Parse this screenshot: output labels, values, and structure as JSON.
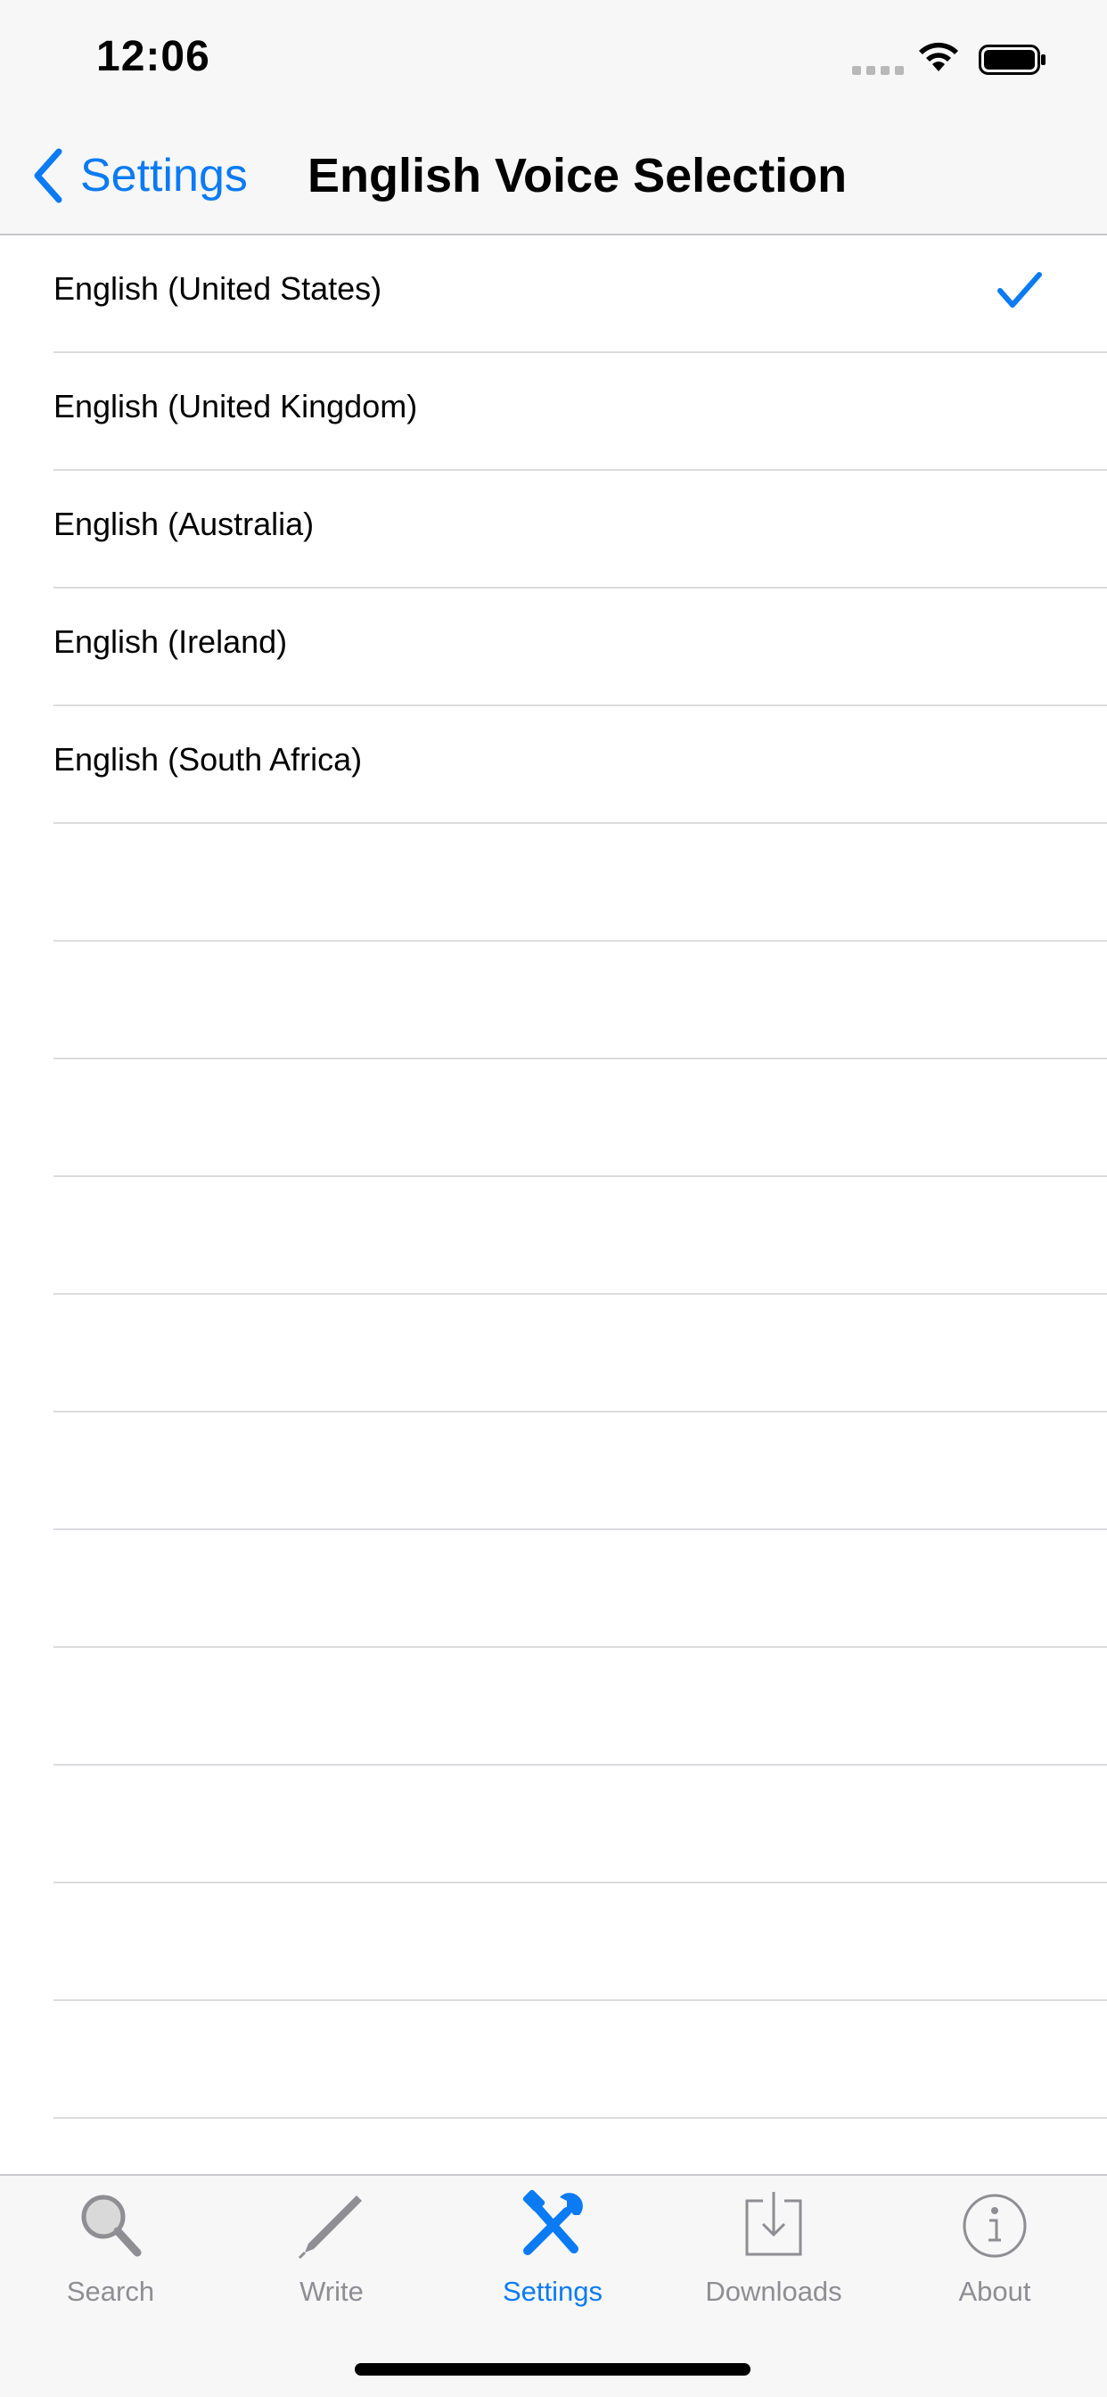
{
  "status_bar": {
    "time": "12:06"
  },
  "nav": {
    "back_label": "Settings",
    "title": "English Voice Selection"
  },
  "voices": [
    {
      "label": "English (United States)",
      "selected": true
    },
    {
      "label": "English (United Kingdom)",
      "selected": false
    },
    {
      "label": "English (Australia)",
      "selected": false
    },
    {
      "label": "English (Ireland)",
      "selected": false
    },
    {
      "label": "English (South Africa)",
      "selected": false
    }
  ],
  "tabs": [
    {
      "label": "Search",
      "icon": "search-icon",
      "active": false
    },
    {
      "label": "Write",
      "icon": "pencil-icon",
      "active": false
    },
    {
      "label": "Settings",
      "icon": "tools-icon",
      "active": true
    },
    {
      "label": "Downloads",
      "icon": "download-icon",
      "active": false
    },
    {
      "label": "About",
      "icon": "info-icon",
      "active": false
    }
  ],
  "colors": {
    "accent": "#0a7bf3",
    "inactive": "#8e8e93",
    "bar_background": "#f7f7f7"
  }
}
